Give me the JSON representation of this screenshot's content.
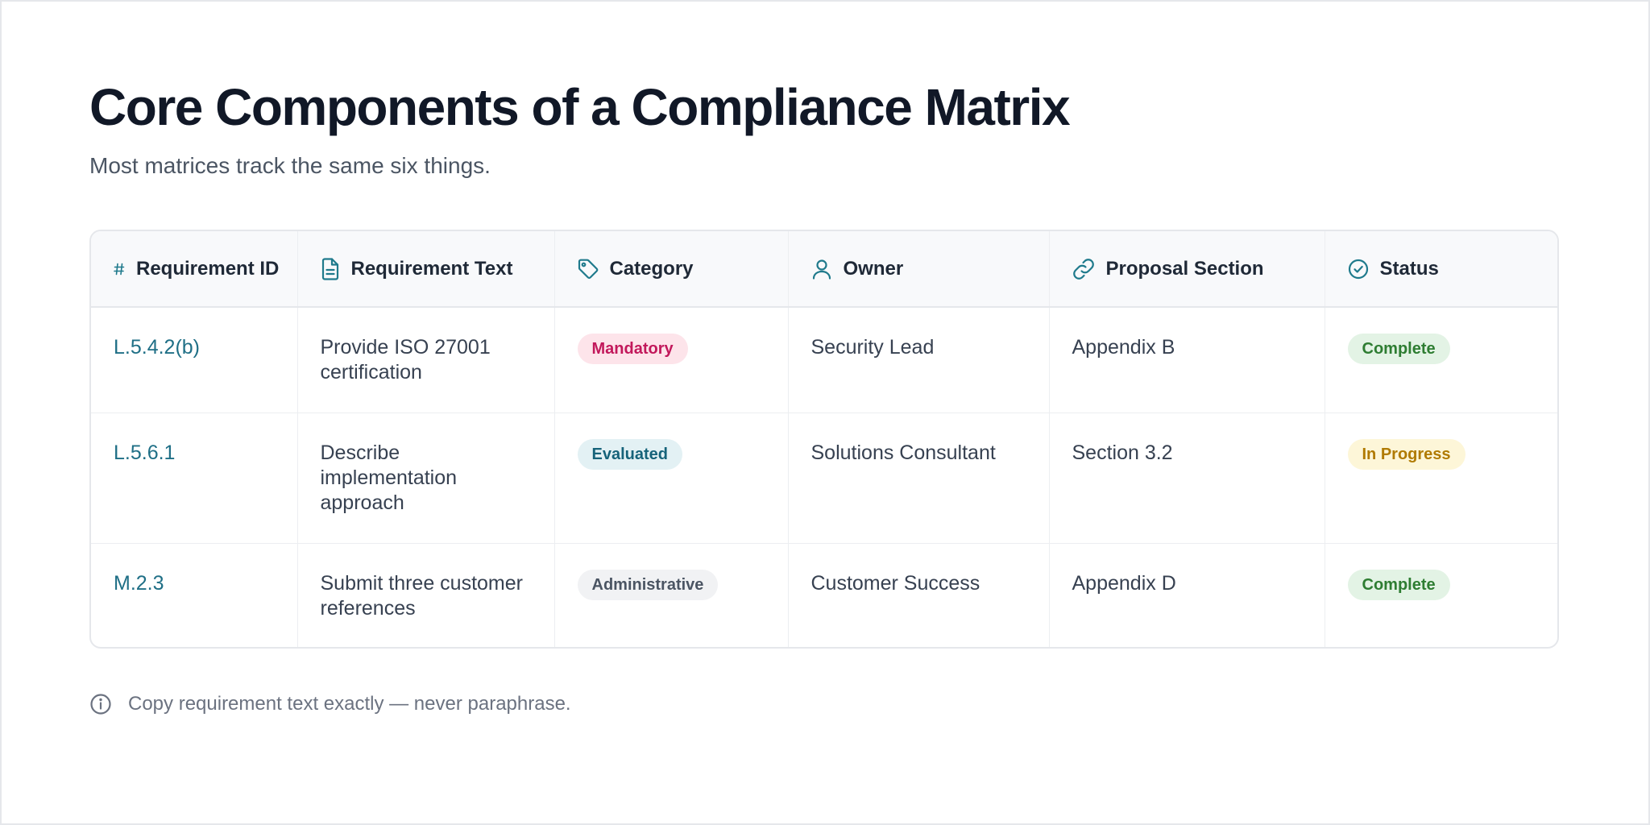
{
  "header": {
    "title": "Core Components of a Compliance Matrix",
    "subtitle": "Most matrices track the same six things."
  },
  "table": {
    "columns": [
      {
        "label": "Requirement ID",
        "icon": "hash-icon"
      },
      {
        "label": "Requirement Text",
        "icon": "document-icon"
      },
      {
        "label": "Category",
        "icon": "tag-icon"
      },
      {
        "label": "Owner",
        "icon": "user-icon"
      },
      {
        "label": "Proposal Section",
        "icon": "link-icon"
      },
      {
        "label": "Status",
        "icon": "check-circle-icon"
      }
    ],
    "rows": [
      {
        "id": "L.5.4.2(b)",
        "text": "Provide ISO 27001 certification",
        "category": "Mandatory",
        "owner": "Security Lead",
        "section": "Appendix B",
        "status": "Complete"
      },
      {
        "id": "L.5.6.1",
        "text": "Describe implementation approach",
        "category": "Evaluated",
        "owner": "Solutions Consultant",
        "section": "Section 3.2",
        "status": "In Progress"
      },
      {
        "id": "M.2.3",
        "text": "Submit three customer references",
        "category": "Administrative",
        "owner": "Customer Success",
        "section": "Appendix D",
        "status": "Complete"
      }
    ]
  },
  "footer": {
    "note": "Copy requirement text exactly — never paraphrase.",
    "icon": "info-icon"
  },
  "colors": {
    "accent": "#1f7a8c",
    "title": "#111827",
    "mandatory": "#c2185b",
    "evaluated": "#16637a",
    "complete": "#2e7d32",
    "in_progress": "#b07a00"
  }
}
